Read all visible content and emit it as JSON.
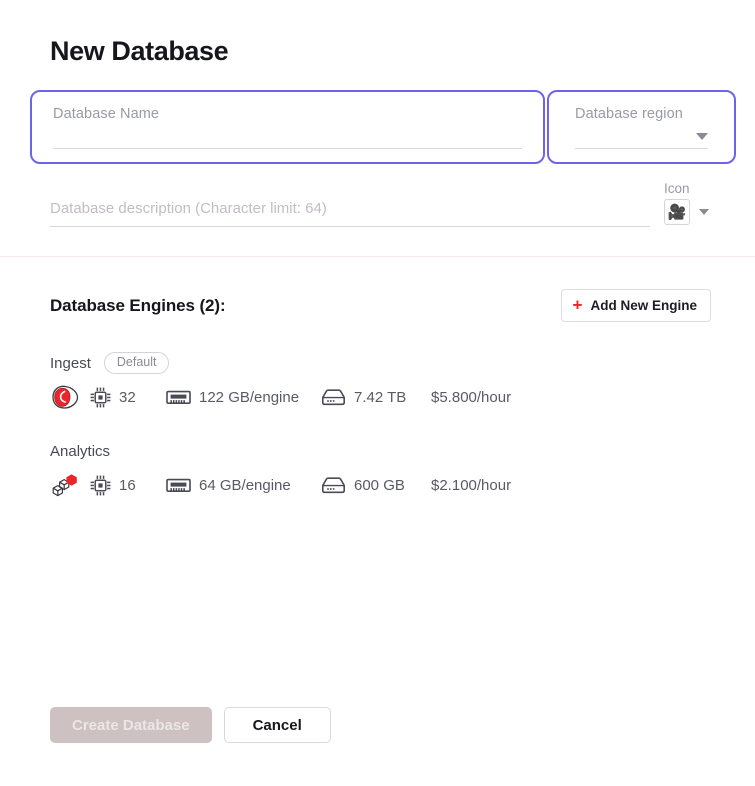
{
  "page_title": "New Database",
  "form": {
    "name_field": {
      "label": "Database Name",
      "value": "",
      "placeholder": ""
    },
    "region_field": {
      "label": "Database region",
      "value": "",
      "placeholder": "",
      "caret_icon": "chevron-down-icon"
    },
    "description_field": {
      "placeholder": "Database description (Character limit: 64)",
      "value": ""
    },
    "icon_picker": {
      "label": "Icon",
      "selected_icon": "🎥",
      "caret_icon": "chevron-down-icon"
    }
  },
  "engines_section": {
    "title": "Database Engines (2):",
    "add_button": {
      "label": "Add New Engine",
      "icon": "plus-icon",
      "icon_glyph": "+",
      "accent": "#e8262c"
    },
    "engines": [
      {
        "name": "Ingest",
        "badge": "Default",
        "logo_icon": "ingest-engine-icon",
        "cpu": "32",
        "ram": "122 GB/engine",
        "disk": "7.42 TB",
        "price": "$5.800/hour"
      },
      {
        "name": "Analytics",
        "badge": "",
        "logo_icon": "analytics-engine-icon",
        "cpu": "16",
        "ram": "64 GB/engine",
        "disk": "600 GB",
        "price": "$2.100/hour"
      }
    ]
  },
  "footer": {
    "create_label": "Create Database",
    "cancel_label": "Cancel"
  },
  "colors": {
    "field_focus_border": "#6f63e8",
    "accent_red": "#e8262c",
    "divider": "#f6e8ee",
    "disabled_button_bg": "#cdc1c1"
  }
}
